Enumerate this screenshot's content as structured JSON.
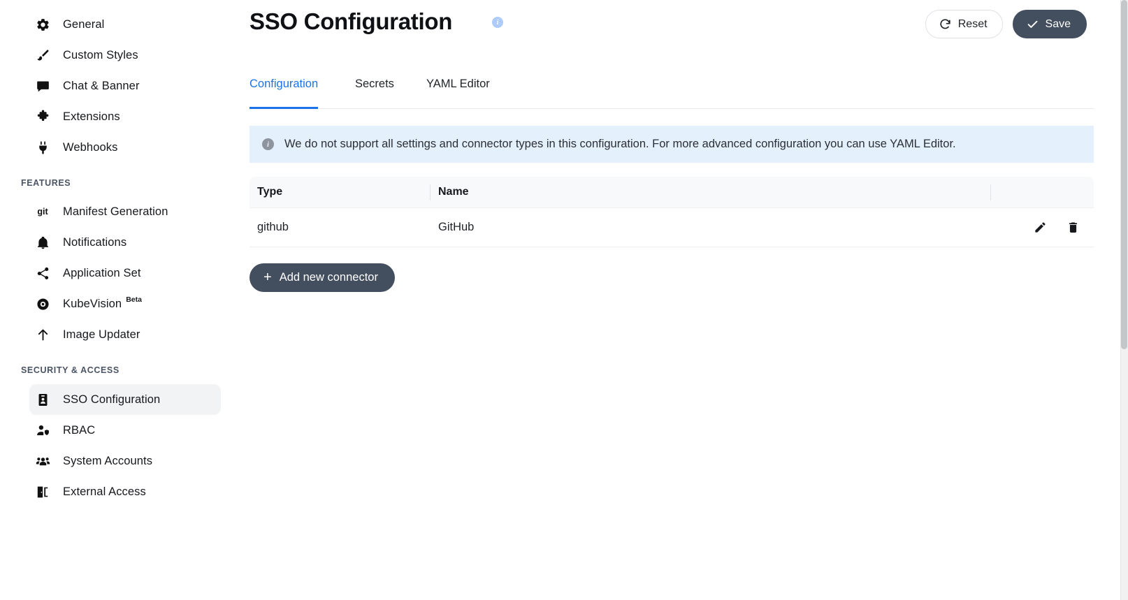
{
  "sidebar": {
    "groups": [
      {
        "label": null,
        "items": [
          {
            "label": "General",
            "icon": "gear-icon",
            "active": false
          },
          {
            "label": "Custom Styles",
            "icon": "brush-icon",
            "active": false
          },
          {
            "label": "Chat & Banner",
            "icon": "chat-bubble-icon",
            "active": false
          },
          {
            "label": "Extensions",
            "icon": "puzzle-piece-icon",
            "active": false
          },
          {
            "label": "Webhooks",
            "icon": "plug-icon",
            "active": false
          }
        ]
      },
      {
        "label": "FEATURES",
        "items": [
          {
            "label": "Manifest Generation",
            "icon": "git-icon",
            "active": false
          },
          {
            "label": "Notifications",
            "icon": "bell-icon",
            "active": false
          },
          {
            "label": "Application Set",
            "icon": "share-nodes-icon",
            "active": false
          },
          {
            "label": "KubeVision",
            "icon": "eye-icon",
            "active": false,
            "badge": "Beta"
          },
          {
            "label": "Image Updater",
            "icon": "arrow-up-icon",
            "active": false
          }
        ]
      },
      {
        "label": "SECURITY & ACCESS",
        "items": [
          {
            "label": "SSO Configuration",
            "icon": "id-badge-icon",
            "active": true
          },
          {
            "label": "RBAC",
            "icon": "user-shield-icon",
            "active": false
          },
          {
            "label": "System Accounts",
            "icon": "users-icon",
            "active": false
          },
          {
            "label": "External Access",
            "icon": "door-open-icon",
            "active": false
          }
        ]
      }
    ]
  },
  "header": {
    "title": "SSO Configuration",
    "info_glyph": "i",
    "reset_label": "Reset",
    "save_label": "Save"
  },
  "tabs": [
    {
      "label": "Configuration",
      "active": true
    },
    {
      "label": "Secrets",
      "active": false
    },
    {
      "label": "YAML Editor",
      "active": false
    }
  ],
  "banner": {
    "glyph": "i",
    "text": "We do not support all settings and connector types in this configuration. For more advanced configuration you can use YAML Editor."
  },
  "table": {
    "columns": [
      "Type",
      "Name"
    ],
    "rows": [
      {
        "type": "github",
        "name": "GitHub"
      }
    ]
  },
  "actions": {
    "add_connector_label": "Add new connector",
    "plus_glyph": "+",
    "edit_icon": "pencil-icon",
    "delete_icon": "trash-icon"
  },
  "colors": {
    "accent_blue": "#1a73e8",
    "dark_button": "#434e5e",
    "banner_bg": "#e4f0fb",
    "active_nav_bg": "#f1f3f4",
    "info_badge": "#aecbfa"
  }
}
